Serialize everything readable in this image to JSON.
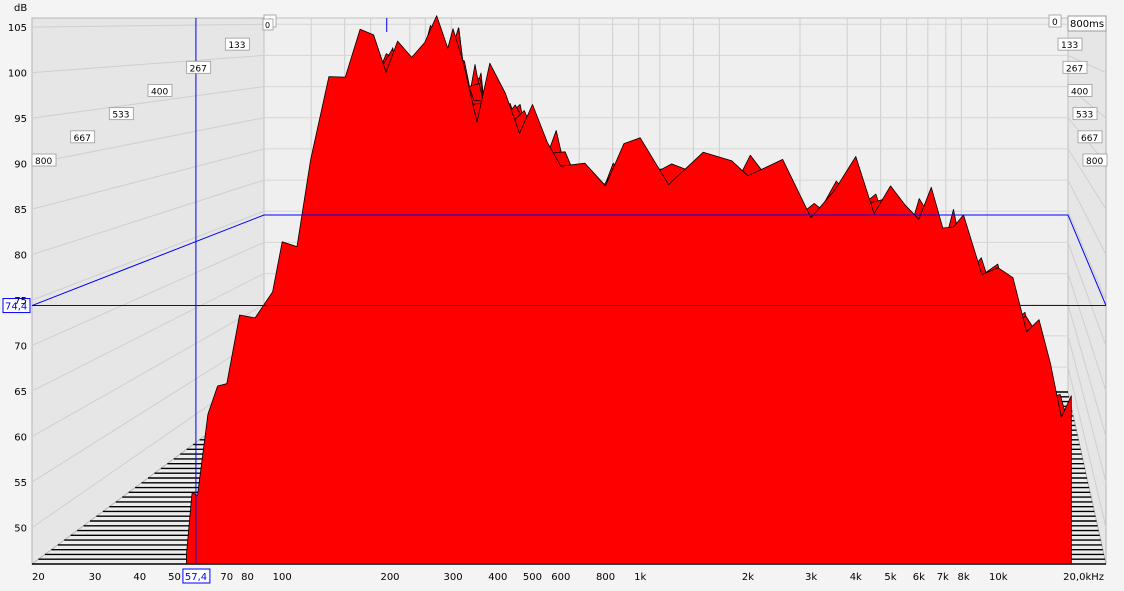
{
  "chart_data": {
    "type": "area",
    "ylabel": "dB",
    "y_ticks": [
      "105",
      "100",
      "95",
      "90",
      "85",
      "80",
      "75",
      "70",
      "65",
      "60",
      "55",
      "50"
    ],
    "ylim": [
      46,
      106
    ],
    "x_unit": "kHz",
    "x_ticks": [
      "20",
      "30",
      "40",
      "50",
      "70",
      "80",
      "100",
      "200",
      "300",
      "400",
      "500",
      "600",
      "800",
      "1k",
      "2k",
      "3k",
      "4k",
      "5k",
      "6k",
      "7k",
      "8k",
      "10k",
      "20,0kHz"
    ],
    "xlim": [
      20,
      20000
    ],
    "x_scale": "log",
    "z_axis_label": "800ms",
    "z_ticks_front": [
      "800",
      "667",
      "533",
      "400",
      "267",
      "133",
      "0"
    ],
    "z_ticks_back": [
      "0",
      "133",
      "267",
      "400",
      "533",
      "667",
      "800"
    ],
    "cursor": {
      "frequency_label": "57,4",
      "level_label": "74,4",
      "frequency": 57.4,
      "level": 74.4
    },
    "color": "#ff0000",
    "envelope_first_slice": {
      "freq": [
        54,
        56,
        58,
        62,
        66,
        70,
        76,
        84,
        94,
        100,
        110,
        120,
        135,
        150,
        165,
        180,
        195,
        210,
        230,
        250,
        270,
        290,
        300,
        320,
        350,
        380,
        420,
        460,
        500,
        550,
        600,
        700,
        800,
        900,
        1000,
        1200,
        1500,
        1800,
        2000,
        2500,
        3000,
        3500,
        4000,
        4500,
        5000,
        5500,
        6000,
        6500,
        7000,
        7500,
        8000,
        9000,
        10000,
        11000,
        12000,
        13000,
        14000,
        15000,
        16000
      ],
      "db": [
        47,
        52,
        56,
        61,
        65,
        68,
        71,
        74,
        77,
        79,
        83,
        90,
        98,
        102,
        103,
        104,
        102,
        101,
        103,
        104,
        104,
        105,
        104,
        100,
        97,
        99,
        98,
        95,
        94,
        94,
        90,
        88,
        90,
        91,
        92,
        90,
        89,
        91,
        90,
        88,
        86,
        87,
        89,
        87,
        86,
        85,
        86,
        85,
        84,
        84,
        82,
        80,
        78,
        76,
        74,
        71,
        68,
        64,
        62
      ]
    }
  }
}
